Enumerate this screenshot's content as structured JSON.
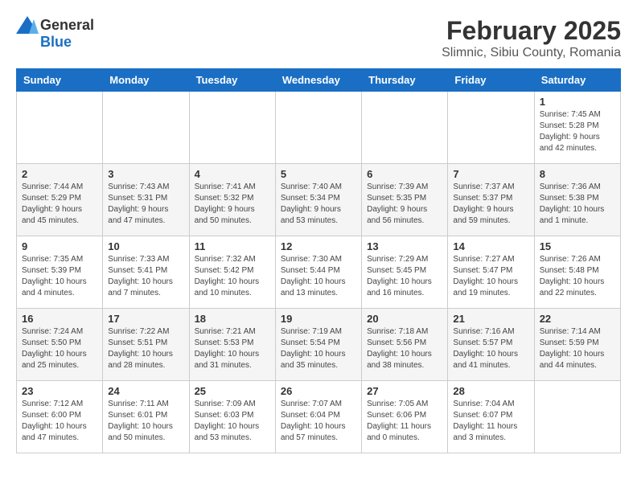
{
  "header": {
    "logo_general": "General",
    "logo_blue": "Blue",
    "title": "February 2025",
    "subtitle": "Slimnic, Sibiu County, Romania"
  },
  "weekdays": [
    "Sunday",
    "Monday",
    "Tuesday",
    "Wednesday",
    "Thursday",
    "Friday",
    "Saturday"
  ],
  "weeks": [
    [
      {
        "day": "",
        "info": ""
      },
      {
        "day": "",
        "info": ""
      },
      {
        "day": "",
        "info": ""
      },
      {
        "day": "",
        "info": ""
      },
      {
        "day": "",
        "info": ""
      },
      {
        "day": "",
        "info": ""
      },
      {
        "day": "1",
        "info": "Sunrise: 7:45 AM\nSunset: 5:28 PM\nDaylight: 9 hours and 42 minutes."
      }
    ],
    [
      {
        "day": "2",
        "info": "Sunrise: 7:44 AM\nSunset: 5:29 PM\nDaylight: 9 hours and 45 minutes."
      },
      {
        "day": "3",
        "info": "Sunrise: 7:43 AM\nSunset: 5:31 PM\nDaylight: 9 hours and 47 minutes."
      },
      {
        "day": "4",
        "info": "Sunrise: 7:41 AM\nSunset: 5:32 PM\nDaylight: 9 hours and 50 minutes."
      },
      {
        "day": "5",
        "info": "Sunrise: 7:40 AM\nSunset: 5:34 PM\nDaylight: 9 hours and 53 minutes."
      },
      {
        "day": "6",
        "info": "Sunrise: 7:39 AM\nSunset: 5:35 PM\nDaylight: 9 hours and 56 minutes."
      },
      {
        "day": "7",
        "info": "Sunrise: 7:37 AM\nSunset: 5:37 PM\nDaylight: 9 hours and 59 minutes."
      },
      {
        "day": "8",
        "info": "Sunrise: 7:36 AM\nSunset: 5:38 PM\nDaylight: 10 hours and 1 minute."
      }
    ],
    [
      {
        "day": "9",
        "info": "Sunrise: 7:35 AM\nSunset: 5:39 PM\nDaylight: 10 hours and 4 minutes."
      },
      {
        "day": "10",
        "info": "Sunrise: 7:33 AM\nSunset: 5:41 PM\nDaylight: 10 hours and 7 minutes."
      },
      {
        "day": "11",
        "info": "Sunrise: 7:32 AM\nSunset: 5:42 PM\nDaylight: 10 hours and 10 minutes."
      },
      {
        "day": "12",
        "info": "Sunrise: 7:30 AM\nSunset: 5:44 PM\nDaylight: 10 hours and 13 minutes."
      },
      {
        "day": "13",
        "info": "Sunrise: 7:29 AM\nSunset: 5:45 PM\nDaylight: 10 hours and 16 minutes."
      },
      {
        "day": "14",
        "info": "Sunrise: 7:27 AM\nSunset: 5:47 PM\nDaylight: 10 hours and 19 minutes."
      },
      {
        "day": "15",
        "info": "Sunrise: 7:26 AM\nSunset: 5:48 PM\nDaylight: 10 hours and 22 minutes."
      }
    ],
    [
      {
        "day": "16",
        "info": "Sunrise: 7:24 AM\nSunset: 5:50 PM\nDaylight: 10 hours and 25 minutes."
      },
      {
        "day": "17",
        "info": "Sunrise: 7:22 AM\nSunset: 5:51 PM\nDaylight: 10 hours and 28 minutes."
      },
      {
        "day": "18",
        "info": "Sunrise: 7:21 AM\nSunset: 5:53 PM\nDaylight: 10 hours and 31 minutes."
      },
      {
        "day": "19",
        "info": "Sunrise: 7:19 AM\nSunset: 5:54 PM\nDaylight: 10 hours and 35 minutes."
      },
      {
        "day": "20",
        "info": "Sunrise: 7:18 AM\nSunset: 5:56 PM\nDaylight: 10 hours and 38 minutes."
      },
      {
        "day": "21",
        "info": "Sunrise: 7:16 AM\nSunset: 5:57 PM\nDaylight: 10 hours and 41 minutes."
      },
      {
        "day": "22",
        "info": "Sunrise: 7:14 AM\nSunset: 5:59 PM\nDaylight: 10 hours and 44 minutes."
      }
    ],
    [
      {
        "day": "23",
        "info": "Sunrise: 7:12 AM\nSunset: 6:00 PM\nDaylight: 10 hours and 47 minutes."
      },
      {
        "day": "24",
        "info": "Sunrise: 7:11 AM\nSunset: 6:01 PM\nDaylight: 10 hours and 50 minutes."
      },
      {
        "day": "25",
        "info": "Sunrise: 7:09 AM\nSunset: 6:03 PM\nDaylight: 10 hours and 53 minutes."
      },
      {
        "day": "26",
        "info": "Sunrise: 7:07 AM\nSunset: 6:04 PM\nDaylight: 10 hours and 57 minutes."
      },
      {
        "day": "27",
        "info": "Sunrise: 7:05 AM\nSunset: 6:06 PM\nDaylight: 11 hours and 0 minutes."
      },
      {
        "day": "28",
        "info": "Sunrise: 7:04 AM\nSunset: 6:07 PM\nDaylight: 11 hours and 3 minutes."
      },
      {
        "day": "",
        "info": ""
      }
    ]
  ]
}
